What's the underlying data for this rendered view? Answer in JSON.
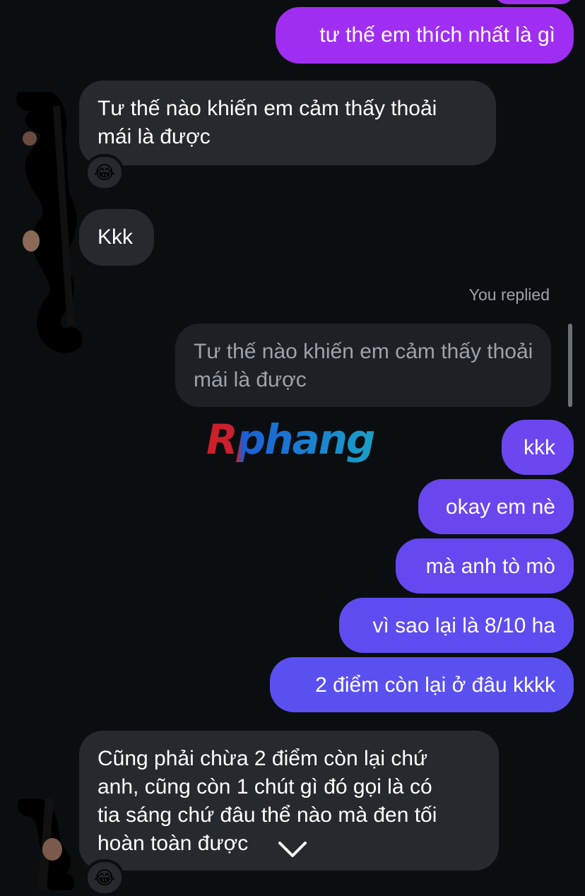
{
  "messages": {
    "sent_top": "tư thế em thích nhất là gì",
    "recv_1_line1": "Tư thế nào khiến em cảm thấy thoải",
    "recv_1_line2": "mái là được",
    "recv_2": "Kkk",
    "reply_status": "You replied",
    "quoted_line1": "Tư thế nào khiến em cảm thấy thoải",
    "quoted_line2": "mái là được",
    "sent_kkk": "kkk",
    "sent_okay": "okay em nè",
    "sent_curious": "mà anh tò mò",
    "sent_why": "vì sao lại là 8/10 ha",
    "sent_2points": "2 điểm còn lại ở đâu kkkk",
    "recv_3_line1": "Cũng phải chừa 2 điểm còn lại chứ",
    "recv_3_line2": "anh, cũng còn 1 chút gì đó gọi là có",
    "recv_3_line3": "tia sáng chứ đâu thể nào mà đen tối",
    "recv_3_line4": "hoàn toàn được"
  },
  "reactions": {
    "r1": "😂",
    "r2": "😂"
  },
  "watermark": "Rphang",
  "colors": {
    "background": "#0b0e11",
    "received_bubble": "#26292e",
    "sent_purple": "#9b2cf0",
    "sent_indigo": "#5b4ff0"
  },
  "icons": {
    "scroll_down": "chevron-down-icon"
  }
}
